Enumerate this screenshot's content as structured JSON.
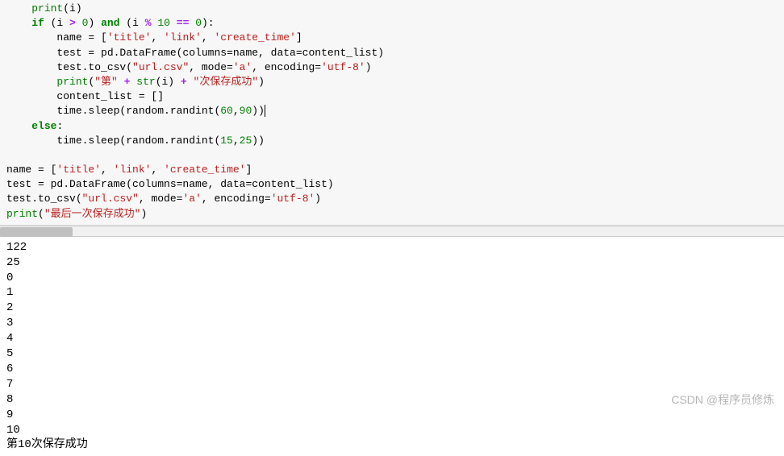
{
  "code": {
    "l0": "print",
    "l0b": "(i)",
    "l1a": "if",
    "l1b": " (i ",
    "l1op1": ">",
    "l1c": " ",
    "l1n1": "0",
    "l1d": ") ",
    "l1and": "and",
    "l1e": " (i ",
    "l1op2": "%",
    "l1f": " ",
    "l1n2": "10",
    "l1g": " ",
    "l1op3": "==",
    "l1h": " ",
    "l1n3": "0",
    "l1i": "):",
    "l2a": "        name = [",
    "l2s1": "'title'",
    "l2b": ", ",
    "l2s2": "'link'",
    "l2c": ", ",
    "l2s3": "'create_time'",
    "l2d": "]",
    "l3": "        test = pd.DataFrame(columns=name, data=content_list)",
    "l4a": "        test.to_csv(",
    "l4s1": "\"url.csv\"",
    "l4b": ", mode=",
    "l4s2": "'a'",
    "l4c": ", encoding=",
    "l4s3": "'utf-8'",
    "l4d": ")",
    "l5a": "        ",
    "l5p": "print",
    "l5b": "(",
    "l5s1": "\"第\"",
    "l5c": " ",
    "l5op1": "+",
    "l5d": " ",
    "l5str": "str",
    "l5e": "(i) ",
    "l5op2": "+",
    "l5f": " ",
    "l5s2": "\"次保存成功\"",
    "l5g": ")",
    "l6": "        content_list = []",
    "l7a": "        time.sleep(random.randint(",
    "l7n1": "60",
    "l7b": ",",
    "l7n2": "90",
    "l7c": "))",
    "l8a": "else",
    "l8b": ":",
    "l9a": "        time.sleep(random.randint(",
    "l9n1": "15",
    "l9b": ",",
    "l9n2": "25",
    "l9c": "))",
    "l11a": "name = [",
    "l11s1": "'title'",
    "l11b": ", ",
    "l11s2": "'link'",
    "l11c": ", ",
    "l11s3": "'create_time'",
    "l11d": "]",
    "l12": "test = pd.DataFrame(columns=name, data=content_list)",
    "l13a": "test.to_csv(",
    "l13s1": "\"url.csv\"",
    "l13b": ", mode=",
    "l13s2": "'a'",
    "l13c": ", encoding=",
    "l13s3": "'utf-8'",
    "l13d": ")",
    "l14p": "print",
    "l14a": "(",
    "l14s": "\"最后一次保存成功\"",
    "l14b": ")"
  },
  "output": {
    "o1": "122",
    "o2": "25",
    "o3": "0",
    "o4": "1",
    "o5": "2",
    "o6": "3",
    "o7": "4",
    "o8": "5",
    "o9": "6",
    "o10": "7",
    "o11": "8",
    "o12": "9",
    "o13": "10",
    "o14": "第10次保存成功"
  },
  "watermark": "CSDN @程序员修炼"
}
